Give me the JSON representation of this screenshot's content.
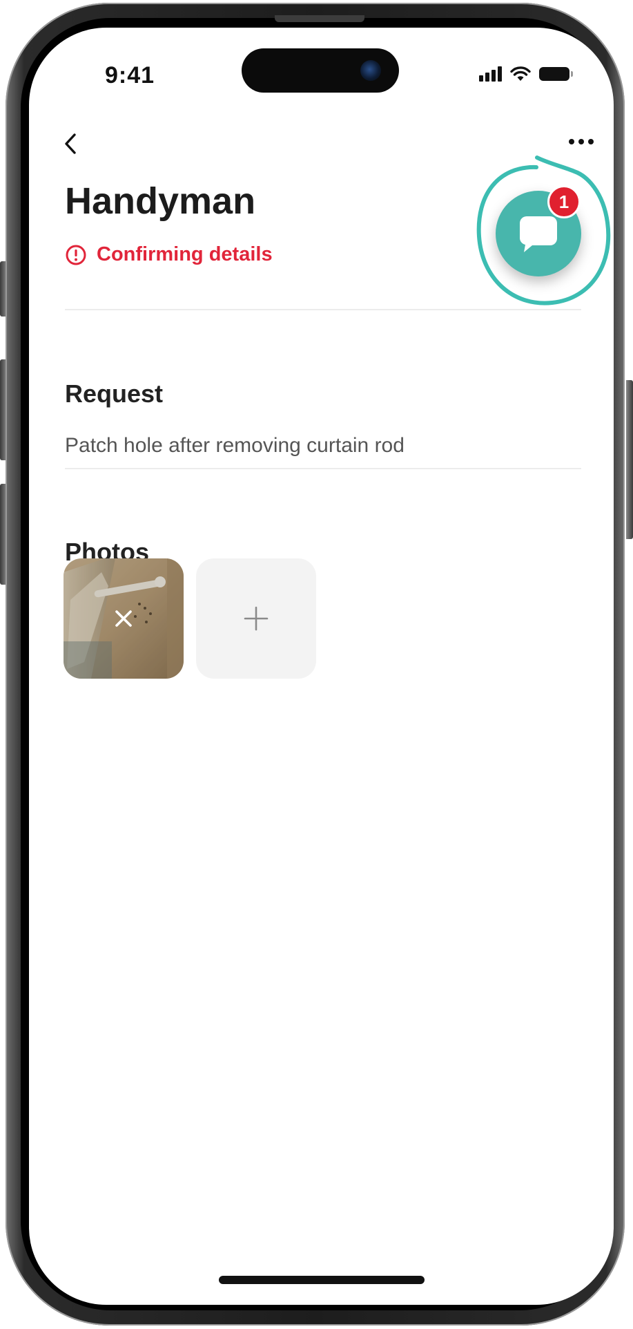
{
  "status_bar": {
    "time": "9:41",
    "icons": [
      "cellular-signal-icon",
      "wifi-icon",
      "battery-icon"
    ]
  },
  "nav": {
    "back_icon": "chevron-left-icon",
    "more_icon": "ellipsis-icon"
  },
  "header": {
    "title": "Handyman",
    "status_label": "Confirming details",
    "status_icon": "alert-circle-icon",
    "status_color": "#e1253a"
  },
  "chat": {
    "icon": "chat-bubble-icon",
    "unread_count": "1",
    "button_color": "#48b6ac",
    "badge_color": "#e0202f",
    "highlight_color": "#3cbdb2"
  },
  "request": {
    "heading": "Request",
    "description": "Patch hole after removing curtain rod"
  },
  "photos": {
    "heading": "Photos",
    "items": [
      {
        "remove_icon": "close-icon"
      }
    ],
    "add_icon": "plus-icon"
  }
}
